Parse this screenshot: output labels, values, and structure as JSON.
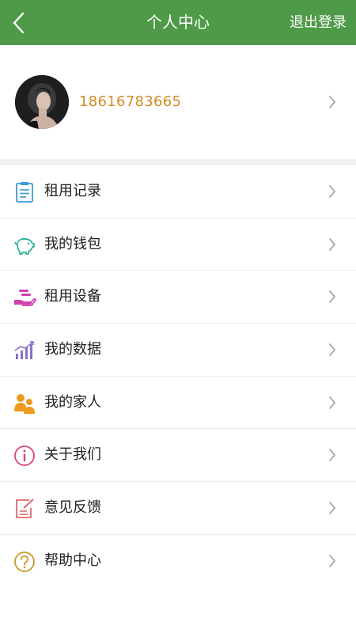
{
  "header": {
    "title": "个人中心",
    "logout_label": "退出登录",
    "color": "#4f9a48"
  },
  "profile": {
    "phone": "18616783665",
    "phone_color": "#d58a24"
  },
  "menu": [
    {
      "label": "租用记录",
      "icon": "clipboard-icon"
    },
    {
      "label": "我的钱包",
      "icon": "piggy-bank-icon"
    },
    {
      "label": "租用设备",
      "icon": "hand-device-icon"
    },
    {
      "label": "我的数据",
      "icon": "bar-chart-icon"
    },
    {
      "label": "我的家人",
      "icon": "family-icon"
    },
    {
      "label": "关于我们",
      "icon": "info-icon"
    },
    {
      "label": "意见反馈",
      "icon": "feedback-icon"
    },
    {
      "label": "帮助中心",
      "icon": "help-icon"
    }
  ]
}
